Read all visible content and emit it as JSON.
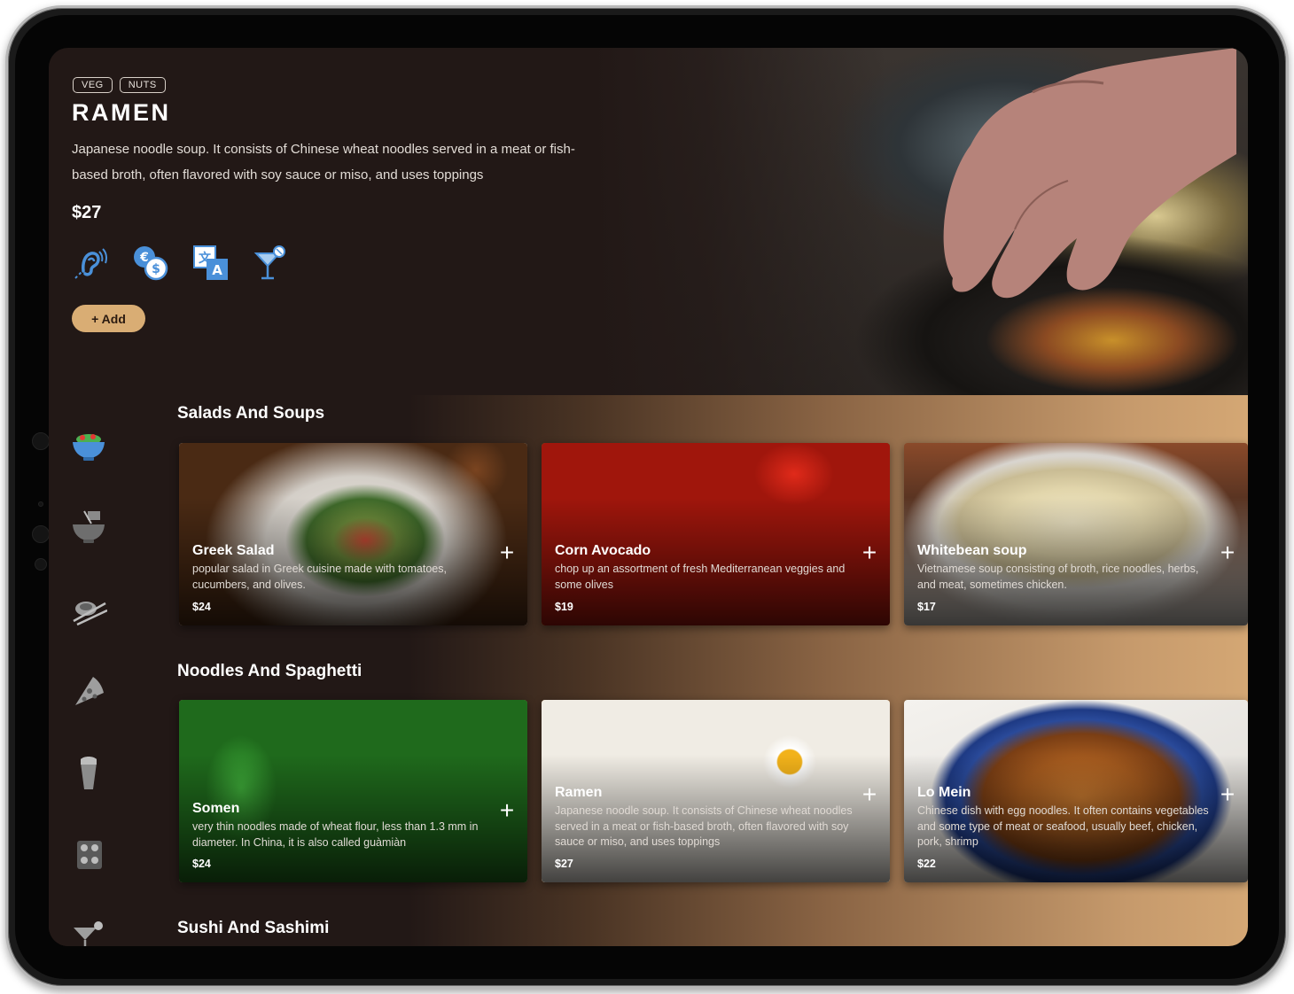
{
  "hero": {
    "tags": [
      "VEG",
      "NUTS"
    ],
    "title": "RAMEN",
    "description": "Japanese noodle soup. It consists of Chinese wheat noodles served in a meat or fish-based broth, often flavored with soy sauce or miso, and uses toppings",
    "price": "$27",
    "feature_icons": [
      "hearing-assist-icon",
      "currency-exchange-icon",
      "translate-icon",
      "cocktail-icon"
    ],
    "add_label": "+ Add"
  },
  "sidebar": {
    "icons": [
      "salad-bowl-icon",
      "noodle-bowl-icon",
      "sushi-icon",
      "pizza-icon",
      "burrito-icon",
      "sushi-roll-icon",
      "cocktail-icon"
    ]
  },
  "sections": [
    {
      "title": "Salads And Soups",
      "items": [
        {
          "name": "Greek Salad",
          "description": "popular salad in Greek cuisine made with tomatoes, cucumbers, and olives.",
          "price": "$24"
        },
        {
          "name": "Corn Avocado",
          "description": "chop up an assortment of fresh Mediterranean veggies and some olives",
          "price": "$19"
        },
        {
          "name": "Whitebean soup",
          "description": "Vietnamese soup consisting of broth, rice noodles, herbs, and meat, sometimes chicken.",
          "price": "$17"
        }
      ]
    },
    {
      "title": "Noodles And Spaghetti",
      "items": [
        {
          "name": "Somen",
          "description": "very thin noodles made of wheat flour, less than 1.3 mm in diameter. In China, it is also called guàmiàn",
          "price": "$24"
        },
        {
          "name": "Ramen",
          "description": "Japanese noodle soup. It consists of Chinese wheat noodles served in a meat or fish-based broth, often flavored with soy sauce or miso, and uses toppings",
          "price": "$27"
        },
        {
          "name": "Lo Mein",
          "description": "Chinese dish with egg noodles. It often contains vegetables and some type of meat or seafood, usually beef, chicken, pork, shrimp",
          "price": "$22"
        }
      ]
    },
    {
      "title": "Sushi And Sashimi",
      "items": []
    }
  ],
  "colors": {
    "background": "#221816",
    "accent": "#d9ad74",
    "icon_blue": "#4a90d9"
  }
}
